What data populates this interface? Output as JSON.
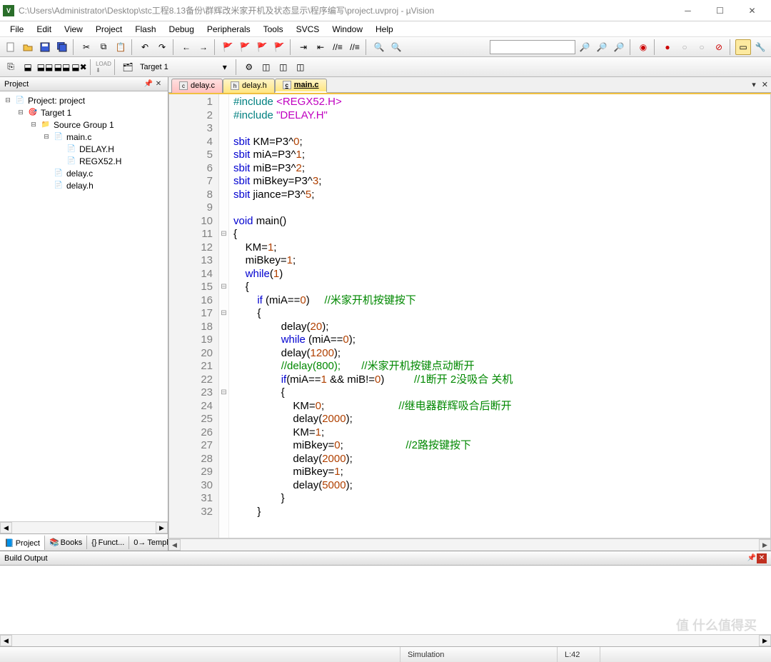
{
  "window": {
    "title": "C:\\Users\\Administrator\\Desktop\\stc工程8.13备份\\群辉改米家开机及状态显示\\程序编写\\project.uvproj - µVision"
  },
  "menu": [
    "File",
    "Edit",
    "View",
    "Project",
    "Flash",
    "Debug",
    "Peripherals",
    "Tools",
    "SVCS",
    "Window",
    "Help"
  ],
  "toolbar2": {
    "target": "Target 1"
  },
  "project": {
    "title": "Project",
    "root": "Project: project",
    "target": "Target 1",
    "group": "Source Group 1",
    "files": [
      "main.c",
      "DELAY.H",
      "REGX52.H",
      "delay.c",
      "delay.h"
    ],
    "tabs": [
      "Project",
      "Books",
      "Funct...",
      "Templ..."
    ]
  },
  "editor_tabs": [
    {
      "name": "delay.c",
      "kind": "red"
    },
    {
      "name": "delay.h",
      "kind": "yel"
    },
    {
      "name": "main.c",
      "kind": "yel",
      "active": true
    }
  ],
  "code": {
    "lines": [
      {
        "n": 1,
        "f": "",
        "seg": [
          [
            "pre",
            "#include"
          ],
          [
            "",
            " "
          ],
          [
            "str",
            "<REGX52.H>"
          ]
        ]
      },
      {
        "n": 2,
        "f": "",
        "seg": [
          [
            "pre",
            "#include"
          ],
          [
            "",
            " "
          ],
          [
            "str",
            "\"DELAY.H\""
          ]
        ]
      },
      {
        "n": 3,
        "f": "",
        "seg": [
          [
            "",
            ""
          ]
        ]
      },
      {
        "n": 4,
        "f": "",
        "seg": [
          [
            "kw",
            "sbit"
          ],
          [
            "",
            " KM=P3^"
          ],
          [
            "num",
            "0"
          ],
          [
            "",
            ";"
          ]
        ]
      },
      {
        "n": 5,
        "f": "",
        "seg": [
          [
            "kw",
            "sbit"
          ],
          [
            "",
            " miA=P3^"
          ],
          [
            "num",
            "1"
          ],
          [
            "",
            ";"
          ]
        ]
      },
      {
        "n": 6,
        "f": "",
        "seg": [
          [
            "kw",
            "sbit"
          ],
          [
            "",
            " miB=P3^"
          ],
          [
            "num",
            "2"
          ],
          [
            "",
            ";"
          ]
        ]
      },
      {
        "n": 7,
        "f": "",
        "seg": [
          [
            "kw",
            "sbit"
          ],
          [
            "",
            " miBkey=P3^"
          ],
          [
            "num",
            "3"
          ],
          [
            "",
            ";"
          ]
        ]
      },
      {
        "n": 8,
        "f": "",
        "seg": [
          [
            "kw",
            "sbit"
          ],
          [
            "",
            " jiance=P3^"
          ],
          [
            "num",
            "5"
          ],
          [
            "",
            ";"
          ]
        ]
      },
      {
        "n": 9,
        "f": "",
        "seg": [
          [
            "",
            ""
          ]
        ]
      },
      {
        "n": 10,
        "f": "",
        "seg": [
          [
            "kw",
            "void"
          ],
          [
            "",
            " main()"
          ]
        ]
      },
      {
        "n": 11,
        "f": "⊟",
        "seg": [
          [
            "",
            "{"
          ]
        ]
      },
      {
        "n": 12,
        "f": "",
        "seg": [
          [
            "",
            "    KM="
          ],
          [
            "num",
            "1"
          ],
          [
            "",
            ";"
          ]
        ]
      },
      {
        "n": 13,
        "f": "",
        "seg": [
          [
            "",
            "    miBkey="
          ],
          [
            "num",
            "1"
          ],
          [
            "",
            ";"
          ]
        ]
      },
      {
        "n": 14,
        "f": "",
        "seg": [
          [
            "",
            "    "
          ],
          [
            "kw",
            "while"
          ],
          [
            "",
            "("
          ],
          [
            "num",
            "1"
          ],
          [
            "",
            ")"
          ]
        ]
      },
      {
        "n": 15,
        "f": "⊟",
        "seg": [
          [
            "",
            "    {"
          ]
        ]
      },
      {
        "n": 16,
        "f": "",
        "seg": [
          [
            "",
            "        "
          ],
          [
            "kw",
            "if"
          ],
          [
            "",
            " (miA=="
          ],
          [
            "num",
            "0"
          ],
          [
            "",
            ")     "
          ],
          [
            "cm",
            "//米家开机按键按下"
          ]
        ]
      },
      {
        "n": 17,
        "f": "⊟",
        "seg": [
          [
            "",
            "        {"
          ]
        ]
      },
      {
        "n": 18,
        "f": "",
        "seg": [
          [
            "",
            "                delay("
          ],
          [
            "num",
            "20"
          ],
          [
            "",
            ");"
          ]
        ]
      },
      {
        "n": 19,
        "f": "",
        "seg": [
          [
            "",
            "                "
          ],
          [
            "kw",
            "while"
          ],
          [
            "",
            " (miA=="
          ],
          [
            "num",
            "0"
          ],
          [
            "",
            ");"
          ]
        ]
      },
      {
        "n": 20,
        "f": "",
        "seg": [
          [
            "",
            "                delay("
          ],
          [
            "num",
            "1200"
          ],
          [
            "",
            ");"
          ]
        ]
      },
      {
        "n": 21,
        "f": "",
        "seg": [
          [
            "",
            "                "
          ],
          [
            "cm",
            "//delay(800);       //米家开机按键点动断开"
          ]
        ]
      },
      {
        "n": 22,
        "f": "",
        "seg": [
          [
            "",
            "                "
          ],
          [
            "kw",
            "if"
          ],
          [
            "",
            "(miA=="
          ],
          [
            "num",
            "1"
          ],
          [
            "",
            " && miB!="
          ],
          [
            "num",
            "0"
          ],
          [
            "",
            ")          "
          ],
          [
            "cm",
            "//1断开 2没吸合 关机"
          ]
        ]
      },
      {
        "n": 23,
        "f": "⊟",
        "seg": [
          [
            "",
            "                {"
          ]
        ]
      },
      {
        "n": 24,
        "f": "",
        "seg": [
          [
            "",
            "                    KM="
          ],
          [
            "num",
            "0"
          ],
          [
            "",
            ";                         "
          ],
          [
            "cm",
            "//继电器群辉吸合后断开"
          ]
        ]
      },
      {
        "n": 25,
        "f": "",
        "seg": [
          [
            "",
            "                    delay("
          ],
          [
            "num",
            "2000"
          ],
          [
            "",
            ");"
          ]
        ]
      },
      {
        "n": 26,
        "f": "",
        "seg": [
          [
            "",
            "                    KM="
          ],
          [
            "num",
            "1"
          ],
          [
            "",
            ";"
          ]
        ]
      },
      {
        "n": 27,
        "f": "",
        "seg": [
          [
            "",
            "                    miBkey="
          ],
          [
            "num",
            "0"
          ],
          [
            "",
            ";                     "
          ],
          [
            "cm",
            "//2路按键按下"
          ]
        ]
      },
      {
        "n": 28,
        "f": "",
        "seg": [
          [
            "",
            "                    delay("
          ],
          [
            "num",
            "2000"
          ],
          [
            "",
            ");"
          ]
        ]
      },
      {
        "n": 29,
        "f": "",
        "seg": [
          [
            "",
            "                    miBkey="
          ],
          [
            "num",
            "1"
          ],
          [
            "",
            ";"
          ]
        ]
      },
      {
        "n": 30,
        "f": "",
        "seg": [
          [
            "",
            "                    delay("
          ],
          [
            "num",
            "5000"
          ],
          [
            "",
            ");"
          ]
        ]
      },
      {
        "n": 31,
        "f": "",
        "seg": [
          [
            "",
            "                }"
          ]
        ]
      },
      {
        "n": 32,
        "f": "",
        "seg": [
          [
            "",
            "        }"
          ]
        ]
      }
    ]
  },
  "buildout": {
    "title": "Build Output"
  },
  "status": {
    "sim": "Simulation",
    "line": "L:42"
  },
  "watermark": "值 什么值得买"
}
